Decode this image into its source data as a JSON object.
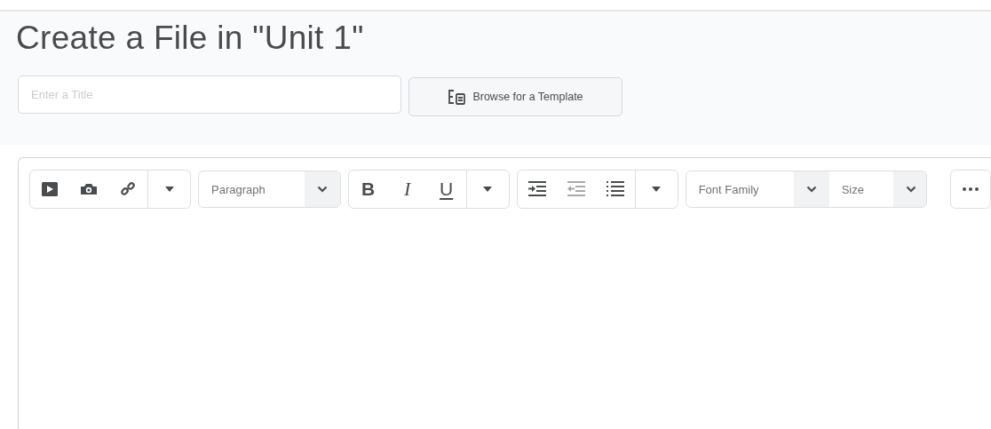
{
  "page": {
    "title": "Create a File in \"Unit 1\""
  },
  "title_field": {
    "placeholder": "Enter a Title"
  },
  "template_button": {
    "label": "Browse for a Template"
  },
  "toolbar": {
    "block_select": {
      "value": "Paragraph"
    },
    "format_buttons": [
      {
        "label": "B"
      },
      {
        "label": "I"
      },
      {
        "label": "U"
      }
    ],
    "list_buttons": [
      {
        "disabled": false
      },
      {
        "disabled": true
      },
      {
        "disabled": false
      }
    ],
    "font_select": {
      "value": "Font Family"
    },
    "size_select": {
      "value": "Size"
    }
  }
}
